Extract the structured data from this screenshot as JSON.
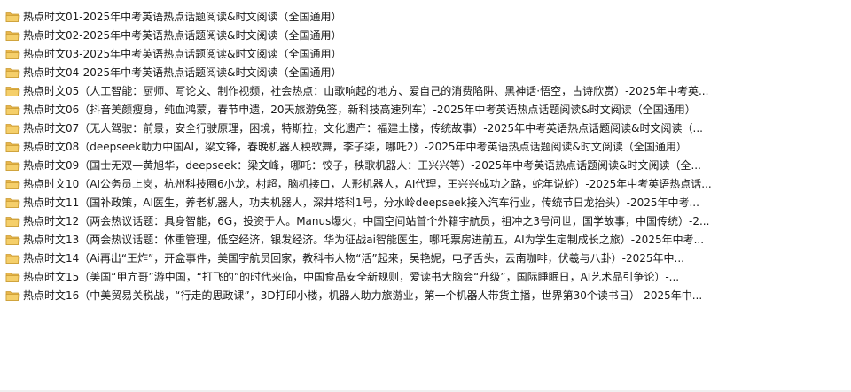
{
  "icons": {
    "item_icon": "folder-icon"
  },
  "colors": {
    "folder_body": "#e8b64c",
    "folder_front": "#f5cf6a",
    "folder_edge": "#c99a30"
  },
  "files": [
    {
      "name": "热点时文01-2025年中考英语热点话题阅读&时文阅读（全国通用）"
    },
    {
      "name": "热点时文02-2025年中考英语热点话题阅读&时文阅读（全国通用）"
    },
    {
      "name": "热点时文03-2025年中考英语热点话题阅读&时文阅读（全国通用）"
    },
    {
      "name": "热点时文04-2025年中考英语热点话题阅读&时文阅读（全国通用）"
    },
    {
      "name": "热点时文05（人工智能：厨师、写论文、制作视频，社会热点：山歌响起的地方、爱自己的消费陷阱、黑神话·悟空，古诗欣赏）-2025年中考英..."
    },
    {
      "name": "热点时文06（抖音美颜瘦身，纯血鸿蒙，春节申遗，20天旅游免签，新科技高速列车）-2025年中考英语热点话题阅读&时文阅读（全国通用）"
    },
    {
      "name": "热点时文07（无人驾驶：前景，安全行驶原理，困境，特斯拉，文化遗产：福建土楼，传统故事）-2025年中考英语热点话题阅读&时文阅读（..."
    },
    {
      "name": "热点时文08（deepseek助力中国AI，梁文锋，春晚机器人秧歌舞，李子柒，哪吒2）-2025年中考英语热点话题阅读&时文阅读（全国通用）"
    },
    {
      "name": "热点时文09（国士无双—黄旭华，deepseek：梁文峰，哪吒：饺子，秧歌机器人：王兴兴等）-2025年中考英语热点话题阅读&时文阅读（全..."
    },
    {
      "name": "热点时文10（AI公务员上岗，杭州科技圈6小龙，村超，脑机接口，人形机器人，AI代理，王兴兴成功之路，蛇年说蛇）-2025年中考英语热点话..."
    },
    {
      "name": "热点时文11（国补政策，AI医生，养老机器人，功夫机器人，深井塔科1号，分水岭deepseek接入汽车行业，传统节日龙抬头）-2025年中考..."
    },
    {
      "name": "热点时文12（两会热议话题：具身智能，6G，投资于人。Manus爆火，中国空间站首个外籍宇航员，祖冲之3号问世，国学故事，中国传统）-2..."
    },
    {
      "name": "热点时文13（两会热议话题：体重管理，低空经济，银发经济。华为征战ai智能医生，哪吒票房进前五，AI为学生定制成长之旅）-2025年中考..."
    },
    {
      "name": "热点时文14（Ai再出“王炸”，开盒事件，美国宇航员回家，教科书人物“活”起来，吴艳妮，电子舌头，云南咖啡，伏羲与八卦）-2025年中..."
    },
    {
      "name": "热点时文15（美国“甲亢哥”游中国，“打飞的”的时代来临，中国食品安全新规则，爱读书大脑会“升级”，国际睡眠日，AI艺术品引争论）-..."
    },
    {
      "name": "热点时文16（中美贸易关税战，“行走的思政课”，3D打印小楼，机器人助力旅游业，第一个机器人带货主播，世界第30个读书日）-2025年中..."
    }
  ]
}
